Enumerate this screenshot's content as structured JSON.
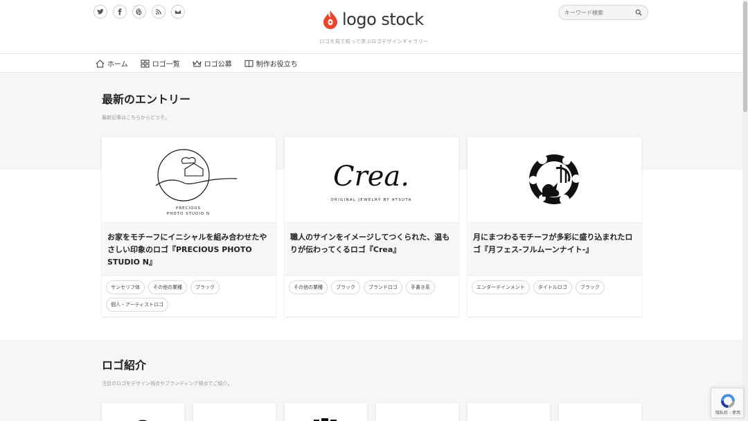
{
  "header": {
    "logo_text": "logo stock",
    "tagline": "ロゴを見て知って学ぶロゴデザインギャラリー",
    "social": [
      "twitter-icon",
      "facebook-icon",
      "pinterest-icon",
      "rss-icon",
      "mail-icon"
    ],
    "search_placeholder": "キーワード検索",
    "accent": "#e8452c"
  },
  "nav": {
    "items": [
      {
        "label": "ホーム",
        "icon": "home-icon"
      },
      {
        "label": "ロゴ一覧",
        "icon": "grid-icon"
      },
      {
        "label": "ロゴ公募",
        "icon": "crown-icon"
      },
      {
        "label": "制作お役立ち",
        "icon": "book-icon"
      }
    ]
  },
  "latest": {
    "title": "最新のエントリー",
    "subtitle": "最新記事はこちらからどうぞ。",
    "cards": [
      {
        "logo_text": "PRECIOUS",
        "logo_text2": "PHOTO STUDIO N",
        "title": "お家をモチーフにイニシャルを組み合わせたやさしい印象のロゴ『PRECIOUS PHOTO STUDIO N』",
        "tags": [
          "サンセリフ体",
          "その他の業種",
          "ブラック",
          "個人・アーティストロゴ"
        ]
      },
      {
        "logo_text": "Crea.",
        "logo_text2": "ORIGINAL JEWELRY BY ATSUTA",
        "title": "職人のサインをイメージしてつくられた、温もりが伝わってくるロゴ『Crea』",
        "tags": [
          "その他の業種",
          "ブラック",
          "ブランドロゴ",
          "手書き系"
        ]
      },
      {
        "title": "月にまつわるモチーフが多彩に盛り込まれたロゴ『月フェス-フルムーンナイト-』",
        "tags": [
          "エンターテインメント",
          "タイトルロゴ",
          "ブラック"
        ]
      }
    ]
  },
  "intro": {
    "title": "ロゴ紹介",
    "subtitle": "注目のロゴをデザイン視点やブランディング視点でご紹介。"
  },
  "recaptcha": {
    "text": "隠私权 - 使用"
  }
}
